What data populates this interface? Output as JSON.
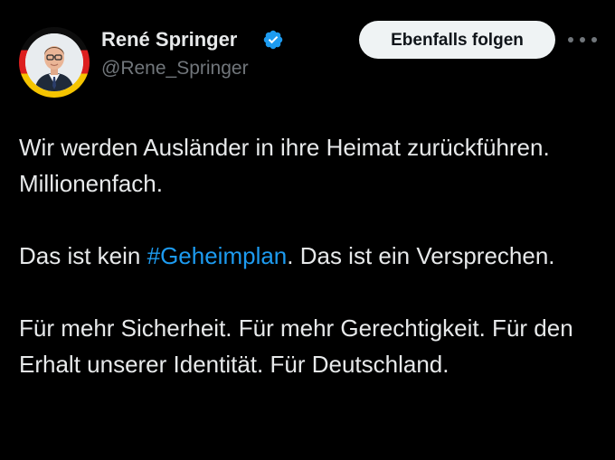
{
  "author": {
    "display_name": "René Springer",
    "handle": "@Rene_Springer",
    "verified": true,
    "avatar_ring_colors": [
      "#0d0d0d",
      "#dd1f1f",
      "#f5c400"
    ]
  },
  "actions": {
    "follow_label": "Ebenfalls folgen",
    "more_icon": "more-horizontal-icon"
  },
  "tweet": {
    "line1": "Wir werden Ausländer in ihre Heimat zurückführen. Millionenfach.",
    "p2_before": "Das ist kein ",
    "p2_hashtag": "#Geheimplan",
    "p2_after": ". Das ist ein Versprechen.",
    "line3": "Für mehr Sicherheit. Für mehr Gerechtigkeit. Für den Erhalt unserer Identität. Für Deutschland."
  },
  "colors": {
    "background": "#000000",
    "text": "#e7e9ea",
    "secondary": "#71767b",
    "link": "#1d9bf0",
    "verified": "#1d9bf0"
  }
}
